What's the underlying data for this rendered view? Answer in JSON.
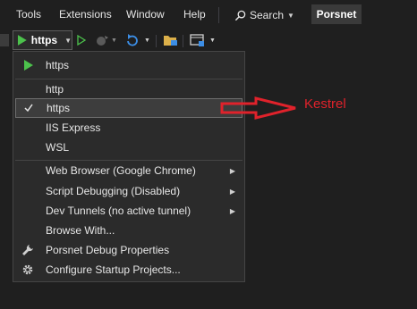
{
  "menubar": {
    "items": [
      "Tools",
      "Extensions",
      "Window",
      "Help"
    ],
    "search_label": "Search",
    "profile_label": "Porsnet"
  },
  "toolbar": {
    "run_label": "https"
  },
  "dropdown": {
    "current_profile": "https",
    "profiles": [
      "http",
      "https",
      "IIS Express",
      "WSL"
    ],
    "selected_profile": "https",
    "submenus": [
      "Web Browser (Google Chrome)",
      "Script Debugging (Disabled)",
      "Dev Tunnels (no active tunnel)"
    ],
    "actions": [
      "Browse With...",
      "Porsnet Debug Properties",
      "Configure Startup Projects..."
    ]
  },
  "annotation": {
    "label": "Kestrel",
    "color": "#e0222b"
  },
  "icons": [
    "play-icon",
    "checkmark-icon",
    "wrench-icon",
    "gear-icon",
    "search-icon",
    "chevron-right-icon"
  ]
}
